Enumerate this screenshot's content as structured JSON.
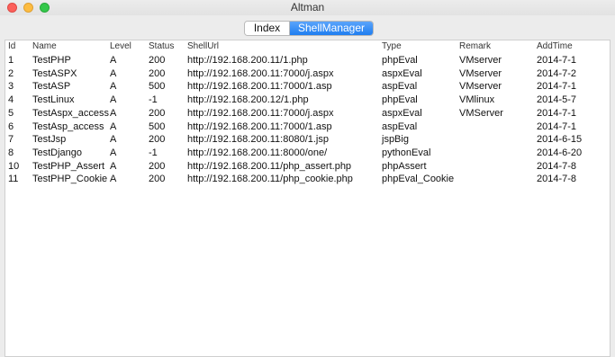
{
  "window": {
    "title": "Altman"
  },
  "tabs": [
    {
      "label": "Index",
      "active": false
    },
    {
      "label": "ShellManager",
      "active": true
    }
  ],
  "table": {
    "columns": [
      "Id",
      "Name",
      "Level",
      "Status",
      "ShellUrl",
      "Type",
      "Remark",
      "AddTime"
    ],
    "rows": [
      [
        "1",
        "TestPHP",
        "A",
        "200",
        "http://192.168.200.11/1.php",
        "phpEval",
        "VMserver",
        "2014-7-1"
      ],
      [
        "2",
        "TestASPX",
        "A",
        "200",
        "http://192.168.200.11:7000/j.aspx",
        "aspxEval",
        "VMserver",
        "2014-7-2"
      ],
      [
        "3",
        "TestASP",
        "A",
        "500",
        "http://192.168.200.11:7000/1.asp",
        "aspEval",
        "VMserver",
        "2014-7-1"
      ],
      [
        "4",
        "TestLinux",
        "A",
        "-1",
        "http://192.168.200.12/1.php",
        "phpEval",
        "VMlinux",
        "2014-5-7"
      ],
      [
        "5",
        "TestAspx_access",
        "A",
        "200",
        "http://192.168.200.11:7000/j.aspx",
        "aspxEval",
        "VMServer",
        "2014-7-1"
      ],
      [
        "6",
        "TestAsp_access",
        "A",
        "500",
        "http://192.168.200.11:7000/1.asp",
        "aspEval",
        "",
        "2014-7-1"
      ],
      [
        "7",
        "TestJsp",
        "A",
        "200",
        "http://192.168.200.11:8080/1.jsp",
        "jspBig",
        "",
        "2014-6-15"
      ],
      [
        "8",
        "TestDjango",
        "A",
        "-1",
        "http://192.168.200.11:8000/one/",
        "pythonEval",
        "",
        "2014-6-20"
      ],
      [
        "10",
        "TestPHP_Assert",
        "A",
        "200",
        "http://192.168.200.11/php_assert.php",
        "phpAssert",
        "",
        "2014-7-8"
      ],
      [
        "11",
        "TestPHP_Cookie",
        "A",
        "200",
        "http://192.168.200.11/php_cookie.php",
        "phpEval_Cookie",
        "",
        "2014-7-8"
      ]
    ]
  },
  "colors": {
    "tab_active": "#1f7ef0",
    "close": "#fc605b",
    "minimize": "#fdbc40",
    "zoom": "#34c84a"
  }
}
